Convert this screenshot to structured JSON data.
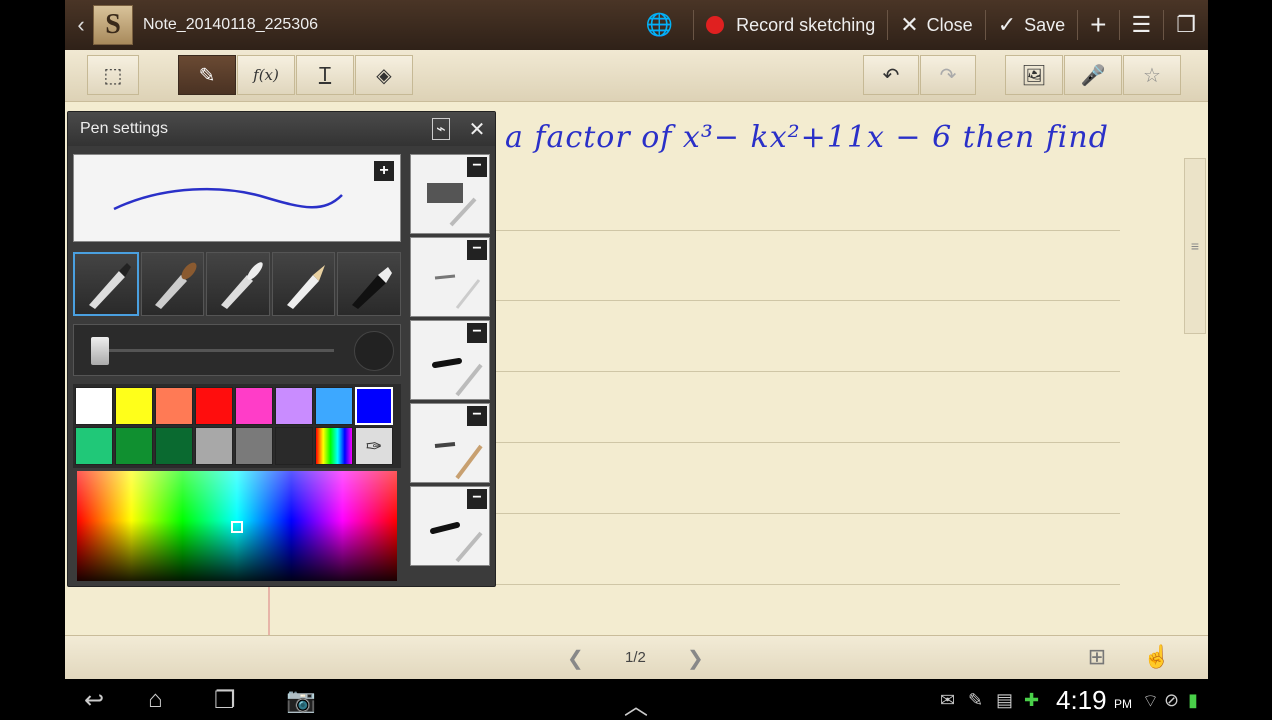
{
  "header": {
    "note_title": "Note_20140118_225306",
    "app_icon_letter": "S",
    "record_label": "Record sketching",
    "close_label": "Close",
    "save_label": "Save"
  },
  "canvas": {
    "handwriting": "a factor of x³− kx²+11x − 6 then find"
  },
  "pen_settings": {
    "title": "Pen settings",
    "colors": [
      "#ffffff",
      "#ffff1a",
      "#ff7a55",
      "#ff0d0d",
      "#ff3dc8",
      "#c98cff",
      "#3da8ff",
      "#0000ff",
      "#20c878",
      "#109030",
      "#0a6a30",
      "#a8a8a8",
      "#7a7a7a",
      "#2a2a2a",
      "rainbow",
      "eyedropper"
    ],
    "selected_color": "#0000ff",
    "pen_type_selected_index": 0
  },
  "pager": {
    "page": "1/2"
  },
  "system": {
    "time": "4:19",
    "ampm": "PM"
  }
}
